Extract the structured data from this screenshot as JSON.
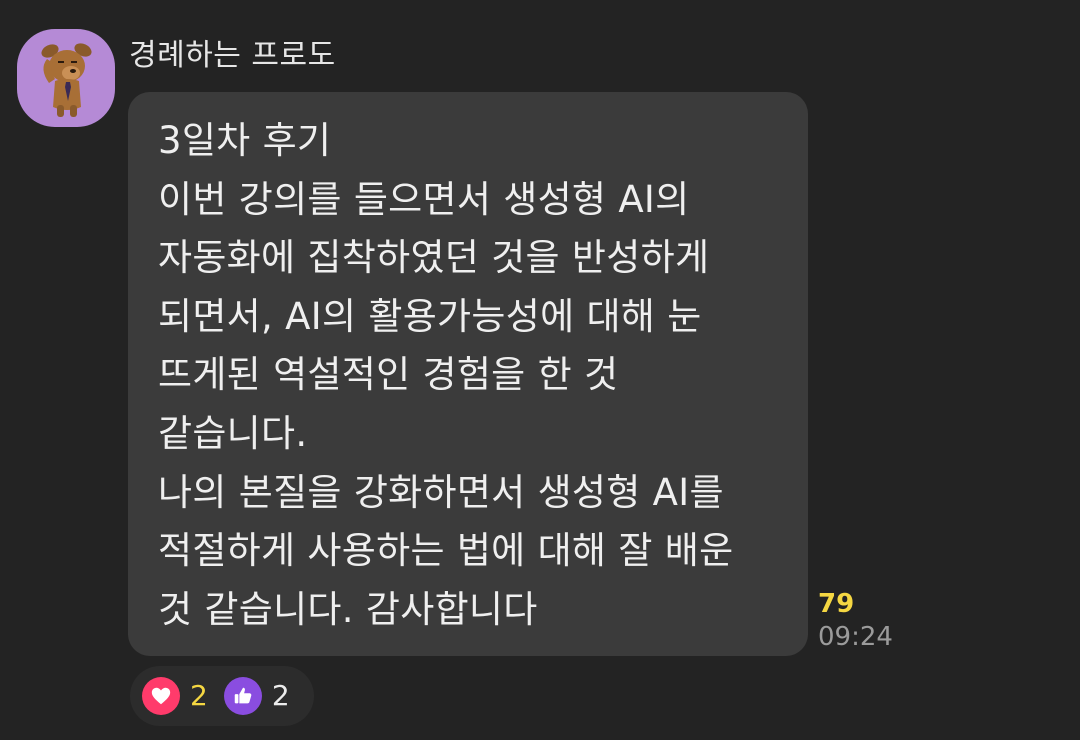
{
  "message": {
    "sender": {
      "name": "경례하는 프로도",
      "avatar": "frodo-saluting-avatar"
    },
    "body_lines": [
      "3일차 후기",
      "이번 강의를 들으면서 생성형 AI의",
      "자동화에 집착하였던 것을 반성하게",
      "되면서, AI의 활용가능성에 대해 눈",
      "뜨게된 역설적인 경험을 한 것",
      "같습니다.",
      "나의 본질을 강화하면서 생성형 AI를",
      "적절하게 사용하는 법에 대해 잘 배운",
      "것 같습니다. 감사합니다"
    ],
    "unread_count": "79",
    "timestamp": "09:24",
    "reactions": [
      {
        "icon": "heart-icon",
        "count": "2",
        "color": "#ff3b6b",
        "count_color": "#f5d742"
      },
      {
        "icon": "thumbs-up-icon",
        "count": "2",
        "color": "#8a4de0",
        "count_color": "#ececec"
      }
    ]
  },
  "colors": {
    "background": "#232323",
    "bubble": "#3b3b3b",
    "avatar_bg": "#b58ad6",
    "unread": "#f5d742",
    "timestamp": "#9b9b9b"
  }
}
